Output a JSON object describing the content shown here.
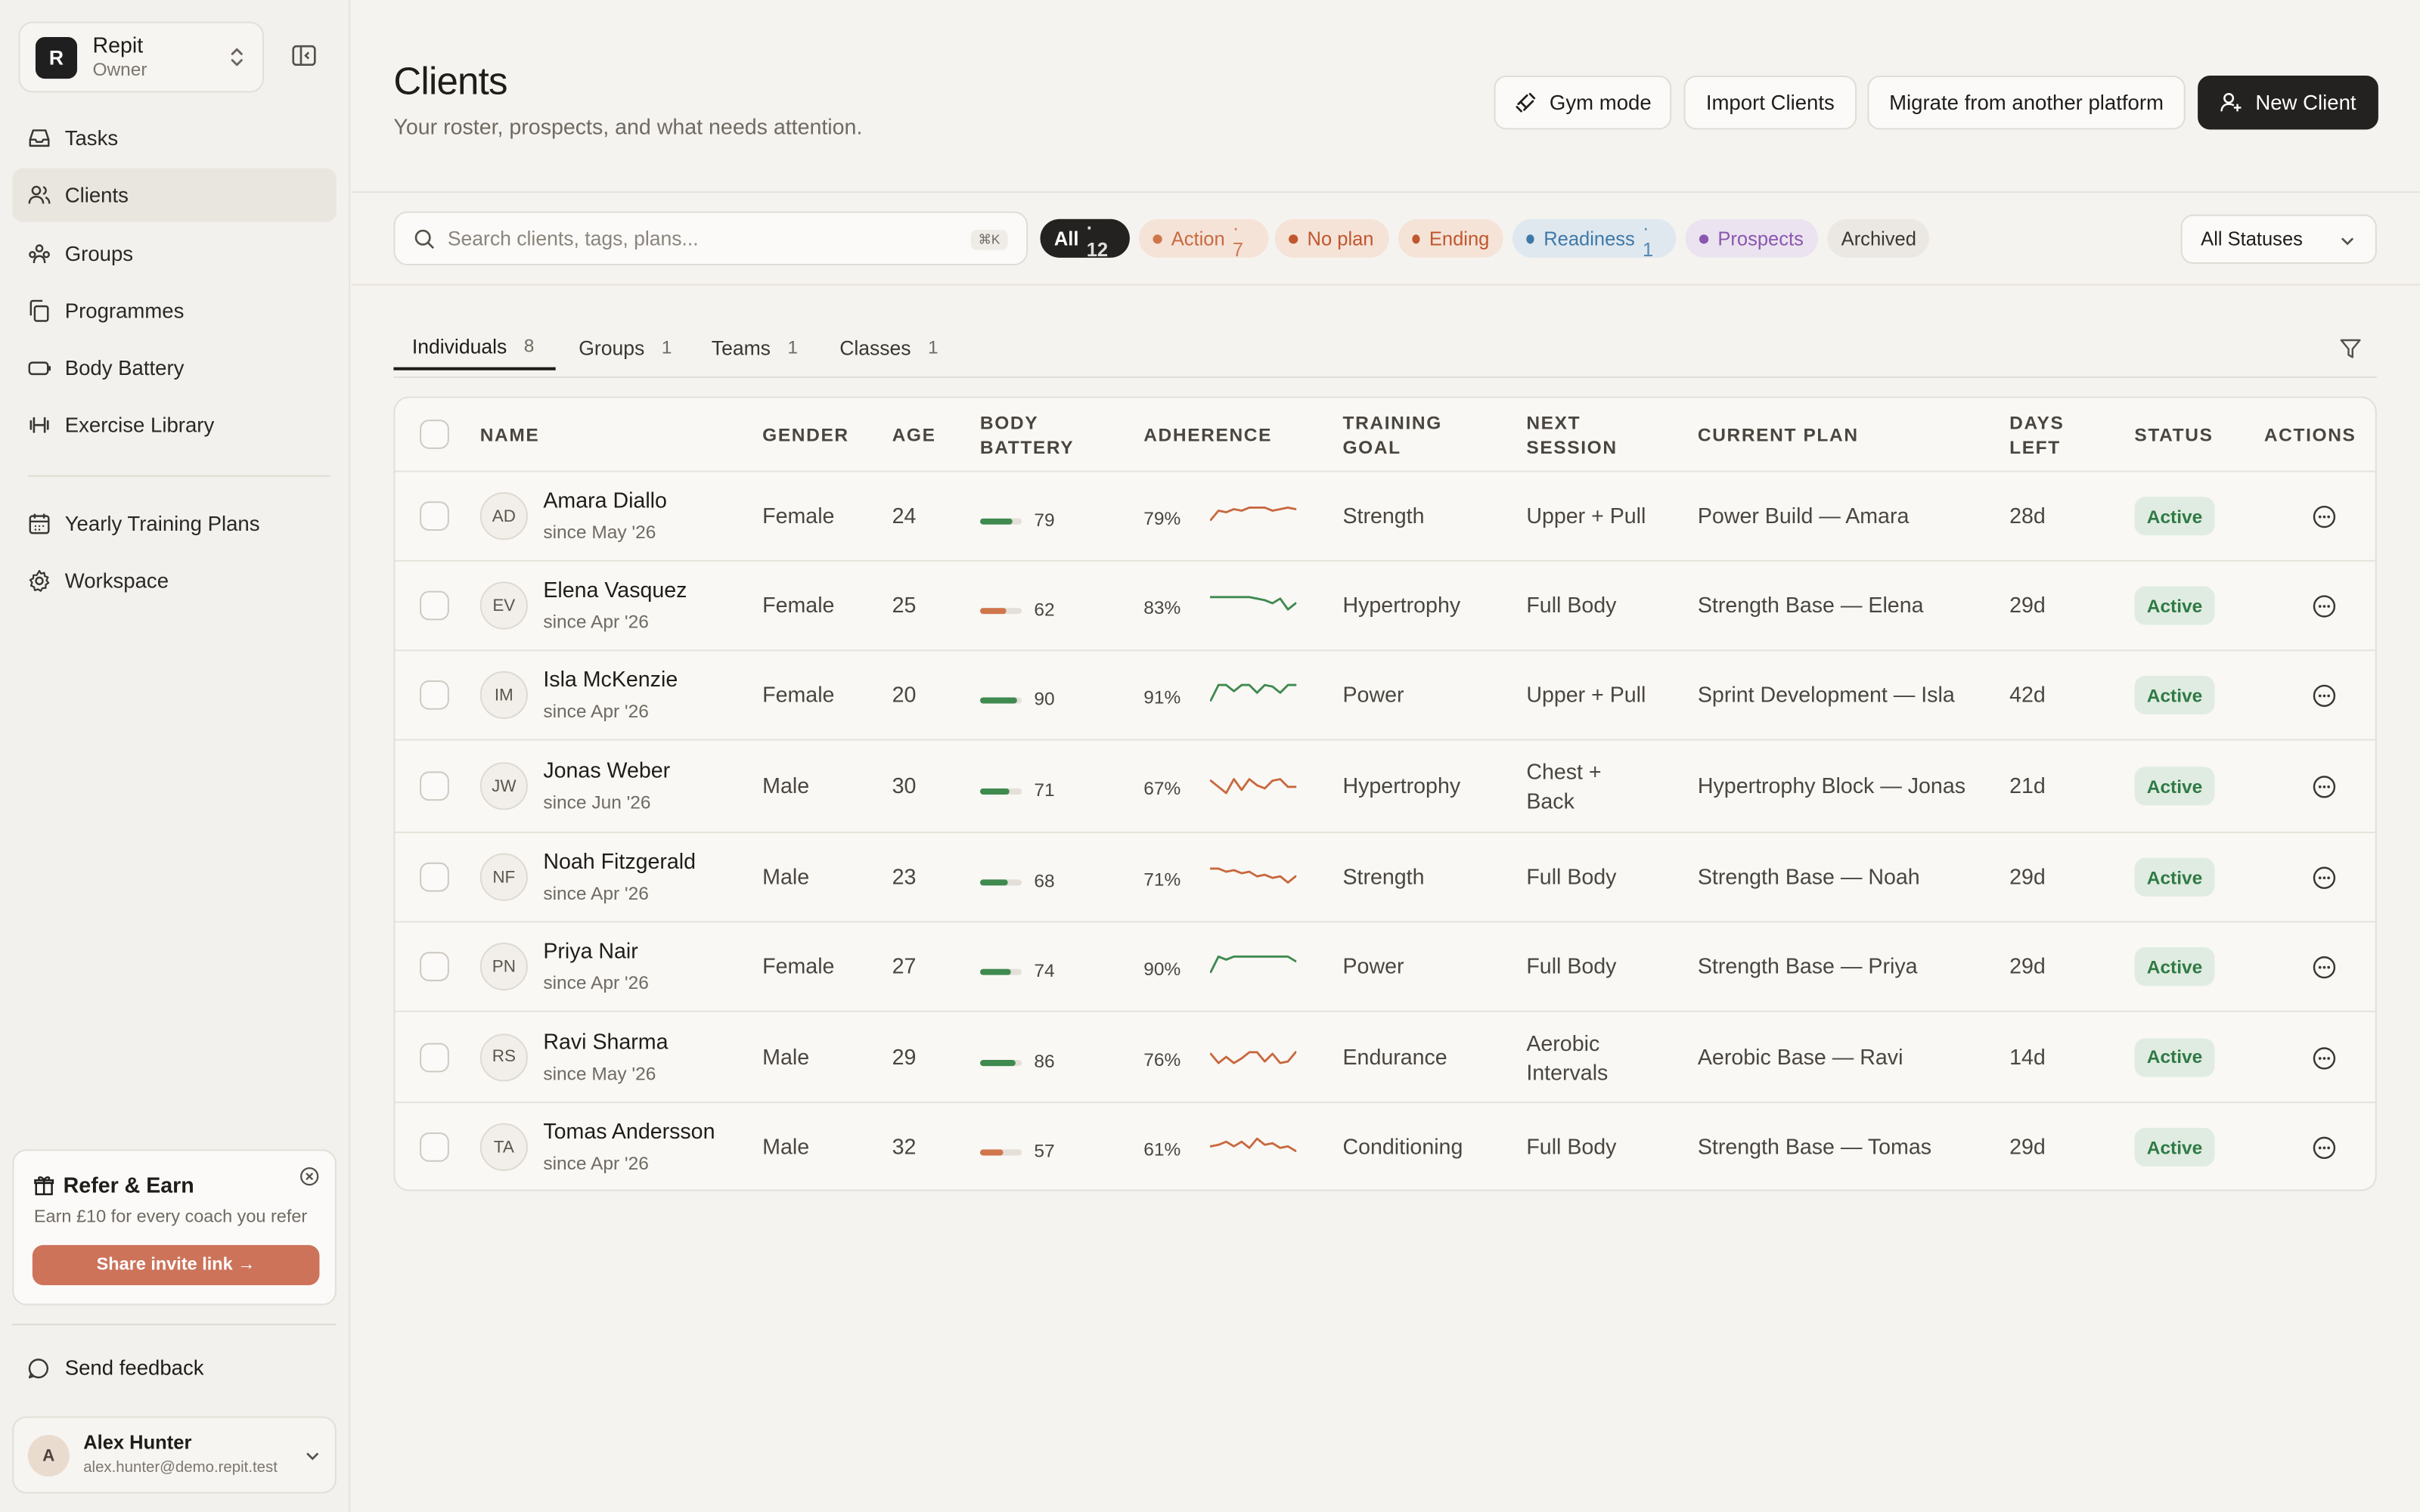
{
  "workspace": {
    "initial": "R",
    "name": "Repit",
    "role": "Owner"
  },
  "nav": [
    {
      "label": "Tasks",
      "icon": "inbox-icon"
    },
    {
      "label": "Clients",
      "icon": "users-icon",
      "active": true
    },
    {
      "label": "Groups",
      "icon": "groups-icon"
    },
    {
      "label": "Programmes",
      "icon": "copy-icon"
    },
    {
      "label": "Body Battery",
      "icon": "battery-icon"
    },
    {
      "label": "Exercise Library",
      "icon": "dumbbell-icon"
    }
  ],
  "nav2": [
    {
      "label": "Yearly Training Plans",
      "icon": "calendar-icon"
    },
    {
      "label": "Workspace",
      "icon": "gear-icon"
    }
  ],
  "refer": {
    "title": "Refer & Earn",
    "subtitle": "Earn £10 for every coach you refer",
    "button": "Share invite link →"
  },
  "feedback": "Send feedback",
  "user": {
    "initial": "A",
    "name": "Alex Hunter",
    "email": "alex.hunter@demo.repit.test"
  },
  "header": {
    "title": "Clients",
    "subtitle": "Your roster, prospects, and what needs attention.",
    "buttons": {
      "gym": "Gym mode",
      "import": "Import Clients",
      "migrate": "Migrate from another platform",
      "new": "New Client"
    }
  },
  "search": {
    "placeholder": "Search clients, tags, plans...",
    "shortcut": "⌘K"
  },
  "chips": [
    {
      "label": "All",
      "count": "· 12",
      "bg": "#232220",
      "fg": "#ffffff",
      "dot": ""
    },
    {
      "label": "Action",
      "count": "· 7",
      "bg": "#f5e3d8",
      "fg": "#c8693f",
      "dot": "#d0764d"
    },
    {
      "label": "No plan",
      "count": "",
      "bg": "#f5e3d8",
      "fg": "#c0572e",
      "dot": "#c0572e"
    },
    {
      "label": "Ending",
      "count": "",
      "bg": "#f5e3d8",
      "fg": "#c0572e",
      "dot": "#c0572e"
    },
    {
      "label": "Readiness",
      "count": "· 1",
      "bg": "#dfe8ef",
      "fg": "#3f79a8",
      "dot": "#3f79a8"
    },
    {
      "label": "Prospects",
      "count": "",
      "bg": "#ebe3ef",
      "fg": "#8a57b0",
      "dot": "#8a57b0"
    },
    {
      "label": "Archived",
      "count": "",
      "bg": "#ebe8e3",
      "fg": "#3a3732",
      "dot": ""
    }
  ],
  "status_filter": "All Statuses",
  "tabs": [
    {
      "label": "Individuals",
      "count": "8",
      "active": true
    },
    {
      "label": "Groups",
      "count": "1"
    },
    {
      "label": "Teams",
      "count": "1"
    },
    {
      "label": "Classes",
      "count": "1"
    }
  ],
  "columns": {
    "name": "NAME",
    "gender": "GENDER",
    "age": "AGE",
    "battery1": "BODY",
    "battery2": "BATTERY",
    "adherence": "ADHERENCE",
    "goal1": "TRAINING",
    "goal2": "GOAL",
    "next1": "NEXT",
    "next2": "SESSION",
    "plan": "CURRENT PLAN",
    "days1": "DAYS",
    "days2": "LEFT",
    "status": "STATUS",
    "actions": "ACTIONS"
  },
  "clients": [
    {
      "initials": "AD",
      "name": "Amara Diallo",
      "since": "since May '26",
      "gender": "Female",
      "age": "24",
      "battery": 79,
      "battery_color": "#3f8a4f",
      "adherence": "79%",
      "trend": [
        6,
        12,
        11,
        13,
        12,
        14,
        14,
        14,
        12,
        13,
        14,
        13
      ],
      "trend_color": "#c8693f",
      "goal": "Strength",
      "next": [
        "Upper + Pull"
      ],
      "plan": "Power Build — Amara",
      "days": "28d",
      "status": "Active"
    },
    {
      "initials": "EV",
      "name": "Elena Vasquez",
      "since": "since Apr '26",
      "gender": "Female",
      "age": "25",
      "battery": 62,
      "battery_color": "#d0764d",
      "adherence": "83%",
      "trend": [
        14,
        14,
        14,
        14,
        14,
        14,
        13,
        12,
        10,
        13,
        6,
        10
      ],
      "trend_color": "#3f8a4f",
      "goal": "Hypertrophy",
      "next": [
        "Full Body"
      ],
      "plan": "Strength Base — Elena",
      "days": "29d",
      "status": "Active"
    },
    {
      "initials": "IM",
      "name": "Isla McKenzie",
      "since": "since Apr '26",
      "gender": "Female",
      "age": "20",
      "battery": 90,
      "battery_color": "#3f8a4f",
      "adherence": "91%",
      "trend": [
        5,
        15,
        15,
        11,
        15,
        15,
        10,
        15,
        14,
        10,
        15,
        15
      ],
      "trend_color": "#3f8a4f",
      "goal": "Power",
      "next": [
        "Upper + Pull"
      ],
      "plan": "Sprint Development — Isla",
      "days": "42d",
      "status": "Active"
    },
    {
      "initials": "JW",
      "name": "Jonas Weber",
      "since": "since Jun '26",
      "gender": "Male",
      "age": "30",
      "battery": 71,
      "battery_color": "#3f8a4f",
      "adherence": "67%",
      "trend": [
        12,
        8,
        4,
        13,
        6,
        13,
        9,
        7,
        12,
        13,
        8,
        8
      ],
      "trend_color": "#c8693f",
      "goal": "Hypertrophy",
      "next": [
        "Chest +",
        "Back"
      ],
      "plan": "Hypertrophy Block — Jonas",
      "days": "21d",
      "status": "Active"
    },
    {
      "initials": "NF",
      "name": "Noah Fitzgerald",
      "since": "since Apr '26",
      "gender": "Male",
      "age": "23",
      "battery": 68,
      "battery_color": "#3f8a4f",
      "adherence": "71%",
      "trend": [
        14,
        14,
        12,
        13,
        11,
        12,
        9,
        10,
        8,
        9,
        5,
        9
      ],
      "trend_color": "#c8693f",
      "goal": "Strength",
      "next": [
        "Full Body"
      ],
      "plan": "Strength Base — Noah",
      "days": "29d",
      "status": "Active"
    },
    {
      "initials": "PN",
      "name": "Priya Nair",
      "since": "since Apr '26",
      "gender": "Female",
      "age": "27",
      "battery": 74,
      "battery_color": "#3f8a4f",
      "adherence": "90%",
      "trend": [
        5,
        15,
        13,
        15,
        15,
        15,
        15,
        15,
        15,
        15,
        15,
        12
      ],
      "trend_color": "#3f8a4f",
      "goal": "Power",
      "next": [
        "Full Body"
      ],
      "plan": "Strength Base — Priya",
      "days": "29d",
      "status": "Active"
    },
    {
      "initials": "RS",
      "name": "Ravi Sharma",
      "since": "since May '26",
      "gender": "Male",
      "age": "29",
      "battery": 86,
      "battery_color": "#3f8a4f",
      "adherence": "76%",
      "trend": [
        11,
        5,
        9,
        5,
        8,
        12,
        12,
        6,
        11,
        5,
        6,
        12
      ],
      "trend_color": "#c8693f",
      "goal": "Endurance",
      "next": [
        "Aerobic",
        "Intervals"
      ],
      "plan": "Aerobic Base — Ravi",
      "days": "14d",
      "status": "Active"
    },
    {
      "initials": "TA",
      "name": "Tomas Andersson",
      "since": "since Apr '26",
      "gender": "Male",
      "age": "32",
      "battery": 57,
      "battery_color": "#d0764d",
      "adherence": "61%",
      "trend": [
        9,
        10,
        12,
        9,
        12,
        8,
        14,
        10,
        11,
        8,
        9,
        6
      ],
      "trend_color": "#c8693f",
      "goal": "Conditioning",
      "next": [
        "Full Body"
      ],
      "plan": "Strength Base — Tomas",
      "days": "29d",
      "status": "Active"
    }
  ]
}
